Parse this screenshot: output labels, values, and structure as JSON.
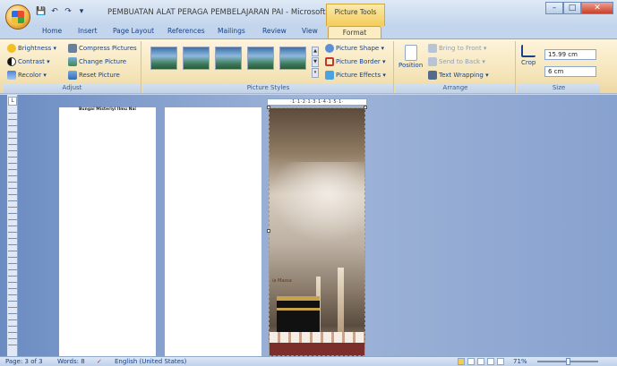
{
  "window": {
    "title": "PEMBUATAN ALAT PERAGA PEMBELAJARAN PAI - Microsoft Wo...",
    "context_tab": "Picture Tools",
    "qat": {
      "save": "💾",
      "undo": "↶",
      "redo": "↷",
      "more": "▾"
    }
  },
  "tabs": [
    "Home",
    "Insert",
    "Page Layout",
    "References",
    "Mailings",
    "Review",
    "View"
  ],
  "active_tab": "Format",
  "ribbon": {
    "adjust": {
      "label": "Adjust",
      "brightness": "Brightness ▾",
      "contrast": "Contrast ▾",
      "recolor": "Recolor ▾",
      "compress": "Compress Pictures",
      "change": "Change Picture",
      "reset": "Reset Picture"
    },
    "styles": {
      "label": "Picture Styles",
      "shape": "Picture Shape ▾",
      "border": "Picture Border ▾",
      "effects": "Picture Effects ▾"
    },
    "arrange": {
      "label": "Arrange",
      "position": "Position",
      "bring_front": "Bring to Front ▾",
      "send_back": "Send to Back ▾",
      "text_wrapping": "Text Wrapping ▾"
    },
    "size": {
      "label": "Size",
      "crop": "Crop",
      "height": "15.99 cm",
      "width": "6 cm"
    }
  },
  "document": {
    "page1_text": "Bungai Misteriyi Ilmu Nai",
    "picture_caption": "ia Massa",
    "ruler": "·1·1·2·1·3·1·4·1·5·1·"
  },
  "status": {
    "page": "Page: 3 of 3",
    "words": "Words: 8",
    "language": "English (United States)",
    "zoom": "71%"
  }
}
